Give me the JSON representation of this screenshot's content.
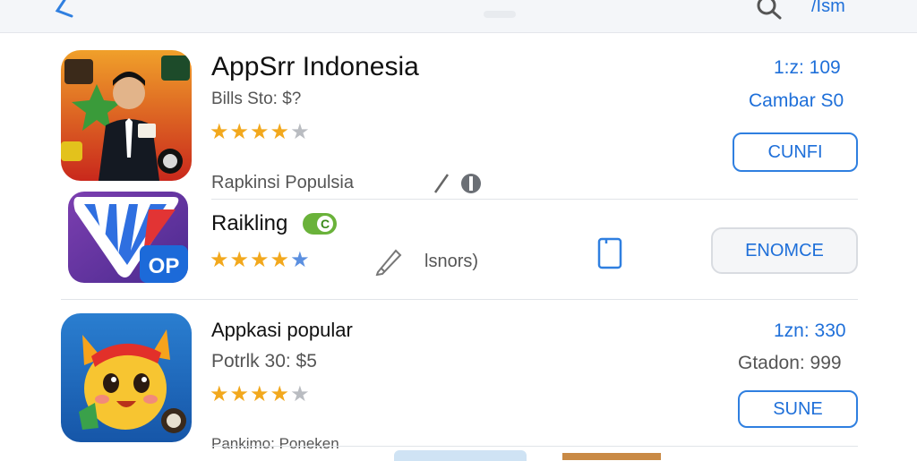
{
  "topbar": {
    "right_text": "/Ism",
    "icons": [
      "back-icon",
      "search-icon"
    ]
  },
  "apps": [
    {
      "title": "AppSrr Indonesia",
      "subtitle": "Bills Sto: $?",
      "rating": 4,
      "meta_top": "1:z: 109",
      "meta_bottom": "Cambar S0",
      "button": "CUNFI",
      "footer_label": "Rapkinsi Populsia"
    },
    {
      "title": "Raikling",
      "badge": "C",
      "rating": 4,
      "note": "lsnors)",
      "button": "ENOMCE",
      "badge_text": "OP",
      "icon_names": [
        "pencil-icon",
        "phone-icon"
      ]
    },
    {
      "title": "Appkasi popular",
      "subtitle": "Potrlk 30: $5",
      "rating": 4,
      "meta_top": "1zn: 330",
      "meta_bottom": "Gtadon: 999",
      "button": "SUNE",
      "footer_label": "Pankimo: Poneken"
    }
  ],
  "colors": {
    "accent": "#1e6fd9",
    "star": "#f2a81d",
    "star_off": "#b9bcc1",
    "green_badge": "#6ab23a"
  }
}
